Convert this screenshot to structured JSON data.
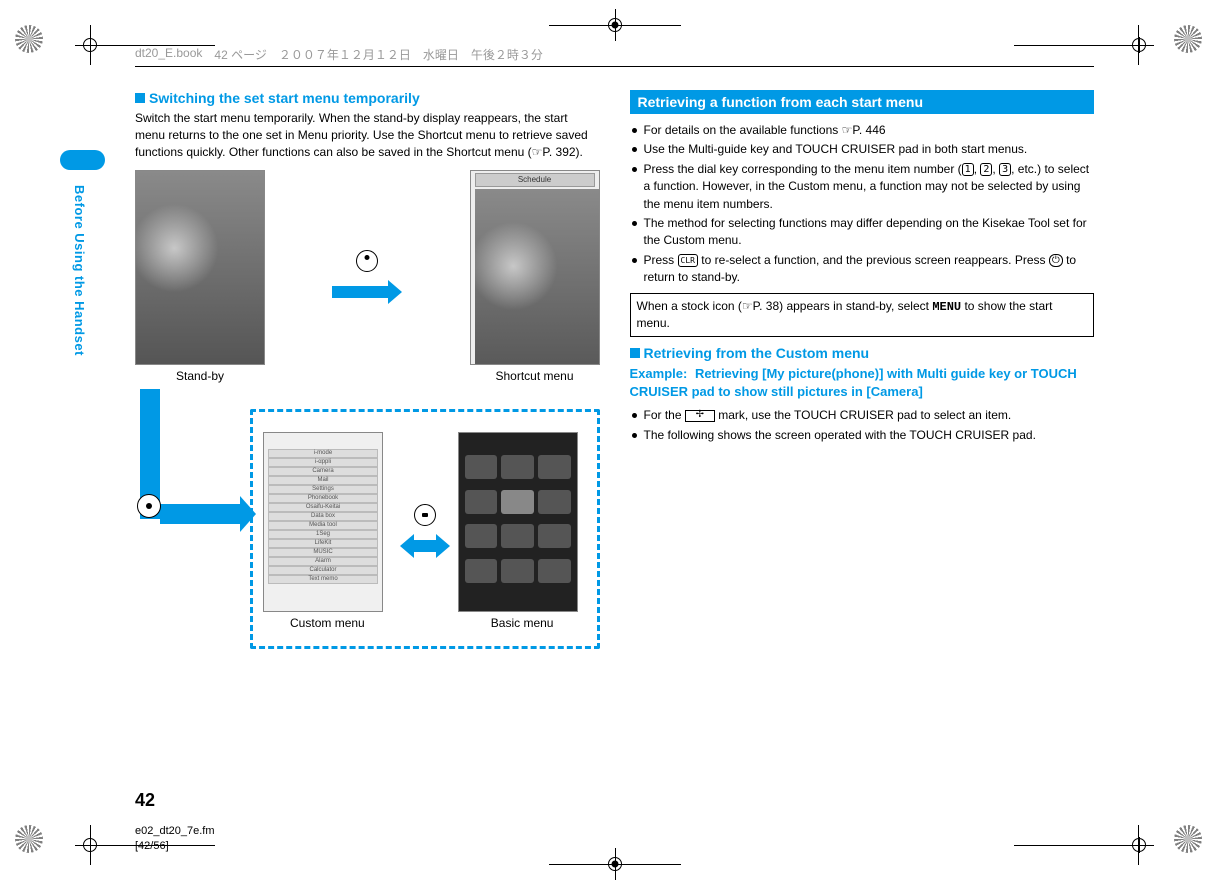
{
  "print_header": {
    "file": "dt20_E.book",
    "page_label": "42 ページ",
    "date": "２００７年１２月１２日　水曜日　午後２時３分"
  },
  "sidebar_label": "Before Using the Handset",
  "left": {
    "title": "Switching the set start menu temporarily",
    "body": "Switch the start menu temporarily. When the stand-by display reappears, the start menu returns to the one set in Menu priority. Use the Shortcut menu to retrieve saved functions quickly. Other functions can also be saved in the Shortcut menu (☞P. 392).",
    "fig": {
      "standby_caption": "Stand-by",
      "shortcut_caption": "Shortcut menu",
      "custom_caption": "Custom menu",
      "basic_caption": "Basic menu"
    }
  },
  "right": {
    "bar_title": "Retrieving a function from each start menu",
    "bullets": [
      "For details on the available functions ☞P. 446",
      "Use the Multi-guide key and TOUCH CRUISER pad in both start menus.",
      "Press the dial key corresponding to the menu item number (1, 2, 3, etc.) to select a function. However, in the Custom menu, a function may not be selected by using the menu item numbers.",
      "The method for selecting functions may differ depending on the Kisekae Tool set for the Custom menu.",
      "Press CLR to re-select a function, and the previous screen reappears. Press 🕿 to return to stand-by."
    ],
    "note": "When a stock icon (☞P. 38) appears in stand-by, select MENU to show the start menu.",
    "subsection_title": "Retrieving from the Custom menu",
    "example_label": "Example:",
    "example_text": "Retrieving [My picture(phone)] with Multi guide key or TOUCH CRUISER pad to show still pictures in [Camera]",
    "post_bullets": [
      "For the ✢ mark, use the TOUCH CRUISER pad to select an item.",
      "The following shows the screen operated with the TOUCH CRUISER pad."
    ]
  },
  "page_number": "42",
  "footer": {
    "filename": "e02_dt20_7e.fm",
    "index": "[42/56]"
  },
  "custom_menu_cells": [
    "i-mode",
    "i-αppli",
    "Camera",
    "Mail",
    "Settings",
    "Phonebook",
    "Osaifu-Keitai",
    "Data box",
    "Media tool",
    "1Seg",
    "LifeKit",
    "MUSIC",
    "Alarm",
    "Calculator",
    "Text memo"
  ]
}
